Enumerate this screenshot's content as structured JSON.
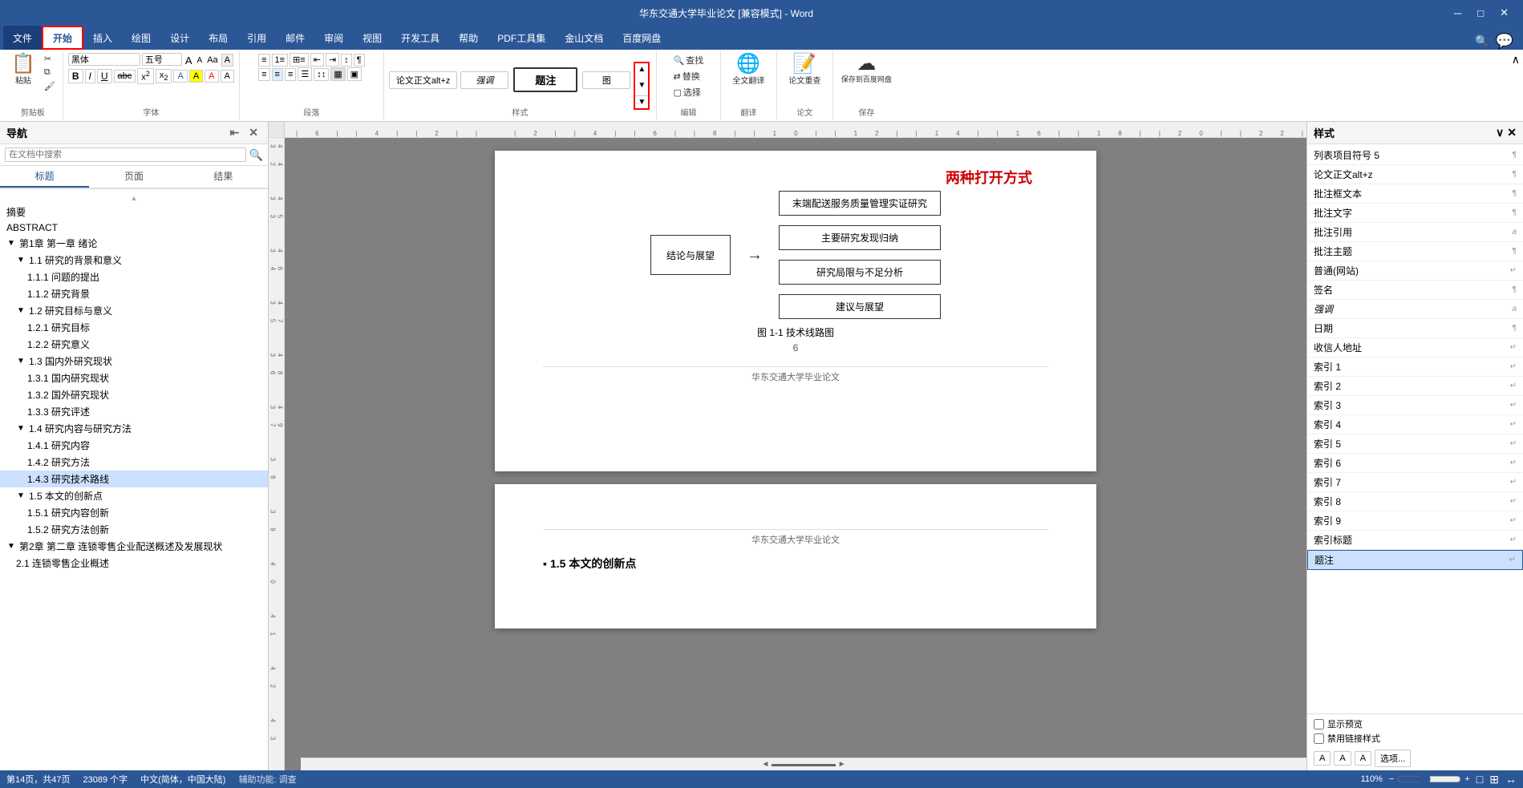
{
  "titlebar": {
    "text": "华东交通大学毕业论文 [兼容模式] - Word",
    "close": "✕",
    "minimize": "─",
    "maximize": "□"
  },
  "ribbon": {
    "tabs": [
      "文件",
      "开始",
      "插入",
      "绘图",
      "设计",
      "布局",
      "引用",
      "邮件",
      "审阅",
      "视图",
      "开发工具",
      "帮助",
      "PDF工具集",
      "金山文档",
      "百度网盘"
    ],
    "active_tab": "开始",
    "groups": {
      "clipboard": {
        "label": "剪贴板",
        "paste_btn": "粘贴",
        "cut": "✂",
        "copy": "⧉",
        "format_paint": "🖌"
      },
      "font": {
        "label": "字体",
        "font_name": "黑体",
        "font_size": "五号",
        "bold": "B",
        "italic": "I",
        "underline": "U",
        "strikethrough": "abc",
        "superscript": "x²",
        "subscript": "x₂"
      },
      "paragraph": {
        "label": "段落"
      },
      "styles": {
        "label": "样式",
        "items": [
          "论文正文alt+z",
          "强调",
          "题注",
          "图"
        ]
      },
      "editing": {
        "label": "编辑",
        "find": "查找",
        "replace": "替换",
        "select": "选择"
      },
      "translate": {
        "label": "翻译",
        "full_translate": "全文翻译"
      },
      "paper": {
        "label": "论文",
        "paper_check": "论文重查"
      },
      "save": {
        "label": "保存",
        "save_to_cloud": "保存到百度网盘"
      }
    }
  },
  "navigation": {
    "title": "导航",
    "search_placeholder": "在文档中搜索",
    "tabs": [
      "标题",
      "页面",
      "结果"
    ],
    "active_tab": "标题",
    "tree": [
      {
        "level": 0,
        "text": "摘要",
        "expanded": false
      },
      {
        "level": 0,
        "text": "ABSTRACT",
        "expanded": false
      },
      {
        "level": 0,
        "text": "第1章 第一章 绪论",
        "expanded": true
      },
      {
        "level": 1,
        "text": "1.1 研究的背景和意义",
        "expanded": true
      },
      {
        "level": 2,
        "text": "1.1.1 问题的提出"
      },
      {
        "level": 2,
        "text": "1.1.2 研究背景"
      },
      {
        "level": 1,
        "text": "1.2 研究目标与意义",
        "expanded": true
      },
      {
        "level": 2,
        "text": "1.2.1 研究目标"
      },
      {
        "level": 2,
        "text": "1.2.2 研究意义"
      },
      {
        "level": 1,
        "text": "1.3 国内外研究现状",
        "expanded": true
      },
      {
        "level": 2,
        "text": "1.3.1 国内研究现状"
      },
      {
        "level": 2,
        "text": "1.3.2 国外研究现状"
      },
      {
        "level": 2,
        "text": "1.3.3 研究评述"
      },
      {
        "level": 1,
        "text": "1.4 研究内容与研究方法",
        "expanded": true
      },
      {
        "level": 2,
        "text": "1.4.1 研究内容"
      },
      {
        "level": 2,
        "text": "1.4.2 研究方法"
      },
      {
        "level": 2,
        "text": "1.4.3 研究技术路线",
        "selected": true
      },
      {
        "level": 1,
        "text": "1.5 本文的创新点",
        "expanded": true
      },
      {
        "level": 2,
        "text": "1.5.1 研究内容创新"
      },
      {
        "level": 2,
        "text": "1.5.2 研究方法创新"
      },
      {
        "level": 0,
        "text": "第2章 第二章 连锁零售企业配送概述及发展现状",
        "expanded": true
      },
      {
        "level": 1,
        "text": "2.1 连锁零售企业概述"
      }
    ]
  },
  "document": {
    "pages": [
      {
        "id": "page1",
        "flowchart": {
          "left_box": "结论与展望",
          "right_boxes": [
            "末端配送服务质量管理实证研究",
            "主要研究发现归纳",
            "研究局限与不足分析",
            "建议与展望"
          ]
        },
        "caption": "图 1-1 技术线路图",
        "page_num": "6",
        "footer": "华东交通大学毕业论文"
      },
      {
        "id": "page2",
        "heading": "1.5 本文的创新点"
      }
    ]
  },
  "styles_panel": {
    "title": "样式",
    "items": [
      {
        "label": "列表项目符号 5",
        "icon": "¶"
      },
      {
        "label": "论文正文alt+z",
        "icon": "¶"
      },
      {
        "label": "批注框文本",
        "icon": "¶"
      },
      {
        "label": "批注文字",
        "icon": "¶"
      },
      {
        "label": "批注引用",
        "icon": "a"
      },
      {
        "label": "批注主题",
        "icon": "¶"
      },
      {
        "label": "普通(网站)",
        "icon": "↵"
      },
      {
        "label": "签名",
        "icon": "¶"
      },
      {
        "label": "强调",
        "icon": "a"
      },
      {
        "label": "日期",
        "icon": "¶"
      },
      {
        "label": "收信人地址",
        "icon": "↵"
      },
      {
        "label": "索引 1",
        "icon": "↵"
      },
      {
        "label": "索引 2",
        "icon": "↵"
      },
      {
        "label": "索引 3",
        "icon": "↵"
      },
      {
        "label": "索引 4",
        "icon": "↵"
      },
      {
        "label": "索引 5",
        "icon": "↵"
      },
      {
        "label": "索引 6",
        "icon": "↵"
      },
      {
        "label": "索引 7",
        "icon": "↵"
      },
      {
        "label": "索引 8",
        "icon": "↵"
      },
      {
        "label": "索引 9",
        "icon": "↵"
      },
      {
        "label": "索引标题",
        "icon": "↵"
      },
      {
        "label": "题注",
        "icon": "↵",
        "selected": true
      }
    ],
    "show_preview": "显示预览",
    "disable_linked": "禁用链接样式",
    "options_btn": "选项...",
    "footer_icons": [
      "A",
      "A",
      "A"
    ]
  },
  "annotation": {
    "text": "两种打开方式",
    "color": "#cc0000"
  },
  "status_bar": {
    "pages": "第14页，共47页",
    "words": "23089 个字",
    "language": "中文(简体，中国大陆)",
    "zoom": "110%",
    "help_text": "辅助功能: 调查"
  }
}
